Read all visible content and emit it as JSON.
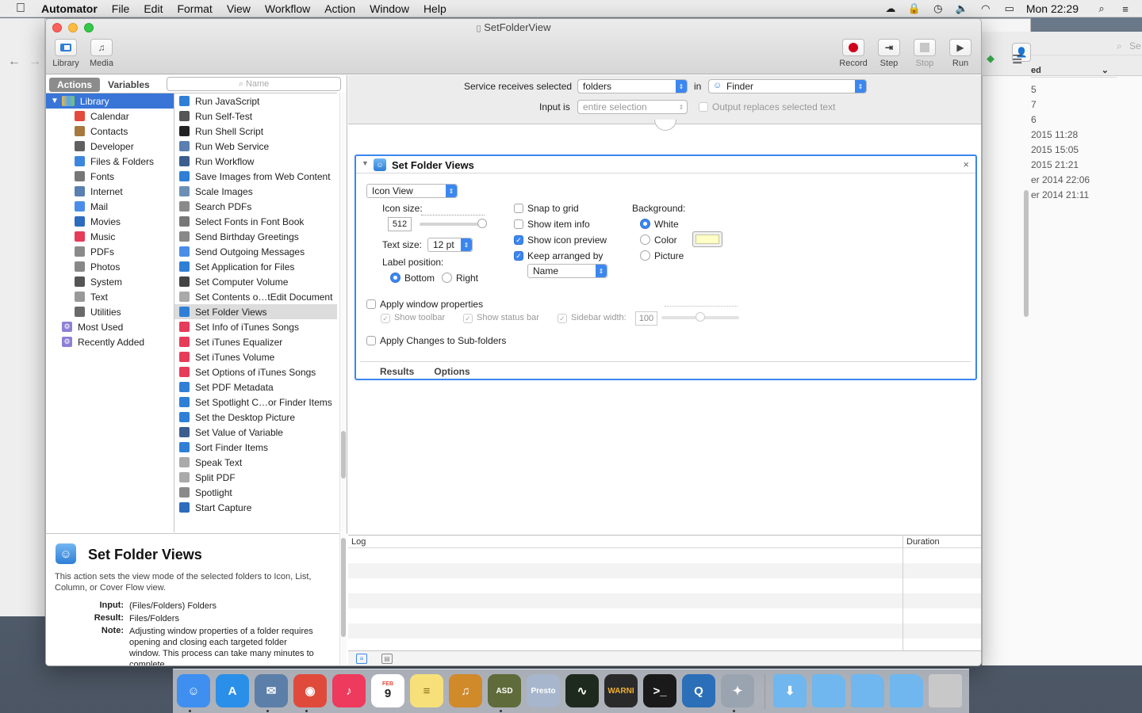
{
  "menubar": {
    "app": "Automator",
    "items": [
      "File",
      "Edit",
      "Format",
      "View",
      "Workflow",
      "Action",
      "Window",
      "Help"
    ],
    "clock": "Mon 22:29"
  },
  "background_window": {
    "column_header": "ed",
    "rows": [
      "5",
      "7",
      "6",
      "2015 11:28",
      "2015 15:05",
      "2015 21:21",
      "er 2014 22:06",
      "er 2014 21:11"
    ],
    "search_placeholder": "Se"
  },
  "window": {
    "title": "SetFolderView",
    "toolbar_left": [
      {
        "label": "Library",
        "icon": "library-icon"
      },
      {
        "label": "Media",
        "icon": "media-icon"
      }
    ],
    "toolbar_right": [
      {
        "label": "Record",
        "icon": "record-icon",
        "enabled": true
      },
      {
        "label": "Step",
        "icon": "step-icon",
        "enabled": true
      },
      {
        "label": "Stop",
        "icon": "stop-icon",
        "enabled": false
      },
      {
        "label": "Run",
        "icon": "run-icon",
        "enabled": true
      }
    ]
  },
  "left_pane": {
    "tabs": [
      "Actions",
      "Variables"
    ],
    "active_tab": "Actions",
    "search_placeholder": "Name",
    "library_root": "Library",
    "library_items": [
      {
        "label": "Calendar",
        "color": "#e34a3c"
      },
      {
        "label": "Contacts",
        "color": "#a5793f"
      },
      {
        "label": "Developer",
        "color": "#606060"
      },
      {
        "label": "Files & Folders",
        "color": "#3c86e0"
      },
      {
        "label": "Fonts",
        "color": "#777777"
      },
      {
        "label": "Internet",
        "color": "#5a7fb0"
      },
      {
        "label": "Mail",
        "color": "#4a8de8"
      },
      {
        "label": "Movies",
        "color": "#2c6bbd"
      },
      {
        "label": "Music",
        "color": "#e73b5a"
      },
      {
        "label": "PDFs",
        "color": "#8a8a8a"
      },
      {
        "label": "Photos",
        "color": "#888888"
      },
      {
        "label": "System",
        "color": "#555555"
      },
      {
        "label": "Text",
        "color": "#999999"
      },
      {
        "label": "Utilities",
        "color": "#6a6a6a"
      }
    ],
    "smart_groups": [
      "Most Used",
      "Recently Added"
    ],
    "actions": [
      "Run JavaScript",
      "Run Self-Test",
      "Run Shell Script",
      "Run Web Service",
      "Run Workflow",
      "Save Images from Web Content",
      "Scale Images",
      "Search PDFs",
      "Select Fonts in Font Book",
      "Send Birthday Greetings",
      "Send Outgoing Messages",
      "Set Application for Files",
      "Set Computer Volume",
      "Set Contents o…tEdit Document",
      "Set Folder Views",
      "Set Info of iTunes Songs",
      "Set iTunes Equalizer",
      "Set iTunes Volume",
      "Set Options of iTunes Songs",
      "Set PDF Metadata",
      "Set Spotlight C…or Finder Items",
      "Set the Desktop Picture",
      "Set Value of Variable",
      "Sort Finder Items",
      "Speak Text",
      "Split PDF",
      "Spotlight",
      "Start Capture"
    ],
    "selected_action": "Set Folder Views",
    "description": {
      "title": "Set Folder Views",
      "text": "This action sets the view mode of the selected folders to Icon, List, Column, or Cover Flow view.",
      "input_label": "Input:",
      "input": "(Files/Folders) Folders",
      "result_label": "Result:",
      "result": "Files/Folders",
      "note_label": "Note:",
      "note": "Adjusting window properties of a folder requires opening and closing each targeted folder window. This process can take many minutes to complete."
    }
  },
  "service_bar": {
    "receives_label": "Service receives selected",
    "receives_value": "folders",
    "in_label": "in",
    "in_value": "Finder",
    "input_is_label": "Input is",
    "input_is_value": "entire selection",
    "output_replaces_label": "Output replaces selected text"
  },
  "action_card": {
    "title": "Set Folder Views",
    "view_popup": "Icon View",
    "icon_size_label": "Icon size:",
    "icon_size_value": "512",
    "icon_size_slider_fraction": 1.0,
    "text_size_label": "Text size:",
    "text_size_value": "12 pt",
    "label_position_label": "Label position:",
    "label_bottom": "Bottom",
    "label_right": "Right",
    "label_position_selected": "Bottom",
    "snap_to_grid": {
      "label": "Snap to grid",
      "checked": false
    },
    "show_item_info": {
      "label": "Show item info",
      "checked": false
    },
    "show_icon_preview": {
      "label": "Show icon preview",
      "checked": true
    },
    "keep_arranged_by": {
      "label": "Keep arranged by",
      "checked": true
    },
    "arrange_popup": "Name",
    "background_label": "Background:",
    "bg_white": "White",
    "bg_color": "Color",
    "bg_picture": "Picture",
    "background_selected": "White",
    "color_swatch": "#fffec4",
    "apply_window_properties": {
      "label": "Apply window properties",
      "checked": false
    },
    "show_toolbar": {
      "label": "Show toolbar",
      "checked": true
    },
    "show_status_bar": {
      "label": "Show status bar",
      "checked": true
    },
    "sidebar_width": {
      "label": "Sidebar width:",
      "checked": true,
      "value": "100"
    },
    "sidebar_slider_fraction": 0.5,
    "apply_subfolders": {
      "label": "Apply Changes to Sub-folders",
      "checked": false
    },
    "tabs": [
      "Results",
      "Options"
    ]
  },
  "log": {
    "col_log": "Log",
    "col_duration": "Duration"
  },
  "dock": {
    "apps": [
      {
        "name": "Finder",
        "color": "#3f8ff0",
        "glyph": "☺"
      },
      {
        "name": "App Store",
        "color": "#2a8fe8",
        "glyph": "A"
      },
      {
        "name": "Preview",
        "color": "#5b7fa8",
        "glyph": "✉"
      },
      {
        "name": "Chrome",
        "color": "#e04a3a",
        "glyph": "◉"
      },
      {
        "name": "iTunes",
        "color": "#ee3a5c",
        "glyph": "♪"
      },
      {
        "name": "Calendar",
        "color": "#ffffff",
        "glyph": "9"
      },
      {
        "name": "Notes",
        "color": "#f7e07a",
        "glyph": "≡"
      },
      {
        "name": "GarageBand",
        "color": "#d08a2a",
        "glyph": "♫"
      },
      {
        "name": "ASD",
        "color": "#5f6b3a",
        "glyph": "ASD"
      },
      {
        "name": "Presto",
        "color": "#a7b6cc",
        "glyph": "Presto"
      },
      {
        "name": "Activity Monitor",
        "color": "#1e2a1e",
        "glyph": "∿"
      },
      {
        "name": "Console",
        "color": "#2a2a2a",
        "glyph": "WARNI"
      },
      {
        "name": "Terminal",
        "color": "#1a1a1a",
        "glyph": ">_"
      },
      {
        "name": "QuickTime",
        "color": "#2b6fb8",
        "glyph": "Q"
      },
      {
        "name": "Automator",
        "color": "#9aa4b0",
        "glyph": "✦"
      }
    ],
    "folders": [
      {
        "name": "Downloads",
        "color": "#6fb7ee"
      },
      {
        "name": "Folder 1",
        "color": "#6fb7ee"
      },
      {
        "name": "Folder 2",
        "color": "#6fb7ee"
      },
      {
        "name": "Folder 3",
        "color": "#6fb7ee"
      },
      {
        "name": "Trash",
        "color": "#c8c8c8"
      }
    ],
    "calendar_month": "FEB"
  }
}
